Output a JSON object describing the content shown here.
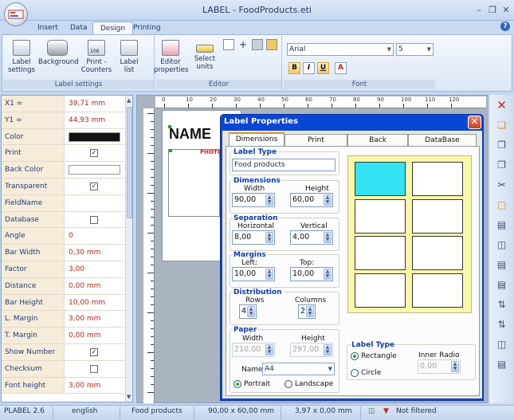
{
  "window": {
    "title": "LABEL - FoodProducts.eti"
  },
  "tabs": [
    "Insert",
    "Data",
    "Design",
    "Printing"
  ],
  "ribbon": {
    "label_settings": {
      "group_label": "Label settings",
      "buttons": [
        "Label settings",
        "Background",
        "Print - Counters",
        "Label list"
      ],
      "counter_text": "108"
    },
    "editor": {
      "group_label": "Editor",
      "buttons": [
        "Editor properties",
        "Select units"
      ]
    },
    "font": {
      "group_label": "Font",
      "family": "Arial",
      "size": "5",
      "bold": "B",
      "italic": "I",
      "underline": "U",
      "color": "A"
    }
  },
  "properties": [
    {
      "name": "X1 =",
      "value": "39,71 mm"
    },
    {
      "name": "Y1 =",
      "value": "44,93 mm"
    },
    {
      "name": "Color",
      "swatch": "#111111"
    },
    {
      "name": "Print",
      "check": "✓"
    },
    {
      "name": "Back Color",
      "swatch": "#ffffff"
    },
    {
      "name": "Transparent",
      "check": "✓"
    },
    {
      "name": "FieldName",
      "value": ""
    },
    {
      "name": "Database",
      "check": ""
    },
    {
      "name": "Angle",
      "value": "0"
    },
    {
      "name": "Bar Width",
      "value": "0,30 mm"
    },
    {
      "name": "Factor",
      "value": "3,00"
    },
    {
      "name": "Distance",
      "value": "0,00 mm"
    },
    {
      "name": "Bar Height",
      "value": "10,00 mm"
    },
    {
      "name": "L. Margin",
      "value": "3,00 mm"
    },
    {
      "name": "T. Margin",
      "value": "0,00 mm"
    },
    {
      "name": "Show Number",
      "check": "✓"
    },
    {
      "name": "Checksum",
      "check": ""
    },
    {
      "name": "Font height",
      "value": "3,00 mm"
    }
  ],
  "canvas": {
    "ruler_top": [
      "0",
      "10",
      "20",
      "30",
      "40",
      "50",
      "60",
      "70",
      "80",
      "90",
      "100",
      "110",
      "120"
    ],
    "label_text": "NAME",
    "photo_text": "PHOTO"
  },
  "dialog": {
    "title": "Label Properties",
    "tabs": [
      "Dimensions",
      "Print",
      "Back",
      "DataBase"
    ],
    "label_type_group": "Label Type",
    "label_type_value": "Food products",
    "dimensions": {
      "title": "Dimensions",
      "width_label": "Width",
      "height_label": "Height",
      "width": "90,00",
      "height": "60,00"
    },
    "separation": {
      "title": "Separation",
      "h_label": "Horizontal",
      "v_label": "Vertical",
      "h": "8,00",
      "v": "4,00"
    },
    "margins": {
      "title": "Margins",
      "left_label": "Left:",
      "top_label": "Top:",
      "left": "10,00",
      "top": "10,00"
    },
    "distribution": {
      "title": "Distribution",
      "rows_label": "Rows",
      "cols_label": "Columns",
      "rows": "4",
      "cols": "2"
    },
    "paper": {
      "title": "Paper",
      "width_label": "Width",
      "height_label": "Height",
      "width": "210,00",
      "height": "297,00",
      "name_label": "Name",
      "name": "A4",
      "portrait": "Portrait",
      "landscape": "Landscape"
    },
    "shape": {
      "title": "Label Type",
      "rectangle": "Rectangle",
      "circle": "Circle",
      "inner_radio_label": "Inner Radio",
      "inner_radio": "0,00"
    }
  },
  "status": {
    "version": "PLABEL 2.6",
    "language": "english",
    "label_type": "Food products",
    "size": "90,00 x 60,00 mm",
    "position": "3,97 x 0,00 mm",
    "filter": "Not filtered"
  }
}
